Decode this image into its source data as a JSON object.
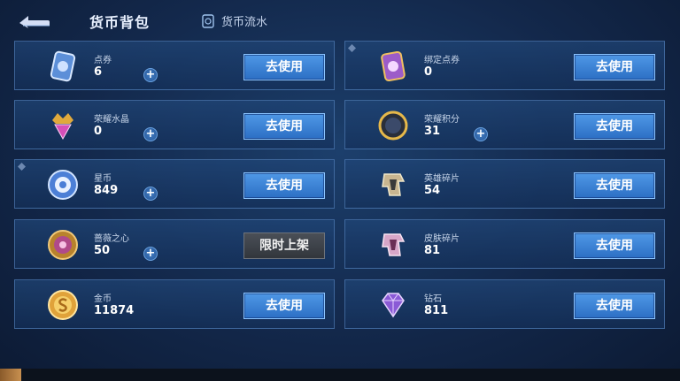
{
  "header": {
    "active_tab": "货币背包",
    "flow_tab": "货币流水"
  },
  "actions": {
    "use_label": "去使用",
    "limited_label": "限时上架"
  },
  "currencies": [
    {
      "name": "点券",
      "count": "6"
    },
    {
      "name": "绑定点券",
      "count": "0"
    },
    {
      "name": "荣耀水晶",
      "count": "0"
    },
    {
      "name": "荣耀积分",
      "count": "31"
    },
    {
      "name": "星币",
      "count": "849"
    },
    {
      "name": "英雄碎片",
      "count": "54"
    },
    {
      "name": "蔷薇之心",
      "count": "50"
    },
    {
      "name": "皮肤碎片",
      "count": "81"
    },
    {
      "name": "金币",
      "count": "11874"
    },
    {
      "name": "钻石",
      "count": "811"
    }
  ],
  "icons": {
    "voucher": "voucher-ticket-icon",
    "bound_voucher": "bound-voucher-ticket-icon",
    "crystal": "honor-crystal-icon",
    "points": "honor-points-icon",
    "star_coin": "star-coin-icon",
    "hero_fragment": "hero-fragment-icon",
    "rose_heart": "rose-heart-icon",
    "skin_fragment": "skin-fragment-icon",
    "gold": "gold-coin-icon",
    "diamond": "diamond-icon"
  },
  "colors": {
    "use_button": "#3c84d6",
    "limited_button": "#3d4249",
    "card_border": "#5c8cc8"
  }
}
